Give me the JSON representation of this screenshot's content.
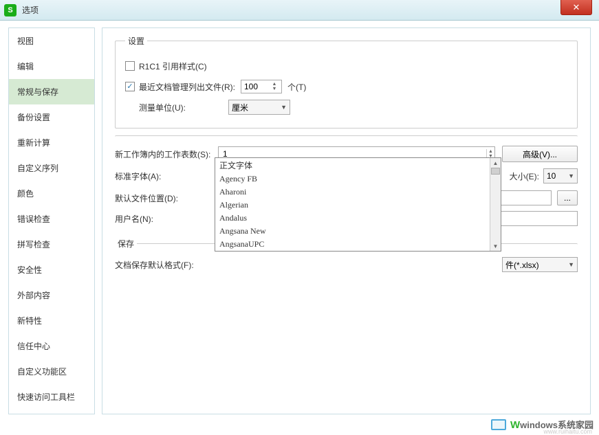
{
  "window": {
    "title": "选项",
    "app_icon_letter": "S"
  },
  "sidebar": {
    "items": [
      {
        "label": "视图"
      },
      {
        "label": "编辑"
      },
      {
        "label": "常规与保存"
      },
      {
        "label": "备份设置"
      },
      {
        "label": "重新计算"
      },
      {
        "label": "自定义序列"
      },
      {
        "label": "颜色"
      },
      {
        "label": "错误检查"
      },
      {
        "label": "拼写检查"
      },
      {
        "label": "安全性"
      },
      {
        "label": "外部内容"
      },
      {
        "label": "新特性"
      },
      {
        "label": "信任中心"
      },
      {
        "label": "自定义功能区"
      },
      {
        "label": "快速访问工具栏"
      }
    ],
    "selected_index": 2
  },
  "settings_group": {
    "legend": "设置",
    "r1c1_label": "R1C1 引用样式(C)",
    "r1c1_checked": false,
    "recent_label": "最近文档管理列出文件(R):",
    "recent_checked": true,
    "recent_value": "100",
    "recent_unit": "个(T)",
    "unit_label": "测量单位(U):",
    "unit_value": "厘米"
  },
  "workbook_group": {
    "sheets_label": "新工作簿内的工作表数(S):",
    "sheets_value": "1",
    "advanced_btn": "高级(V)...",
    "font_label": "标准字体(A):",
    "font_value": "正文字体",
    "size_label": "大小(E):",
    "size_value": "10",
    "default_loc_label": "默认文件位置(D):",
    "username_label": "用户名(N):",
    "dots": "..."
  },
  "font_dropdown": {
    "options": [
      "正文字体",
      "Agency FB",
      "Aharoni",
      "Algerian",
      "Andalus",
      "Angsana New",
      "AngsanaUPC"
    ]
  },
  "save_group": {
    "legend": "保存",
    "format_label": "文档保存默认格式(F):",
    "format_value_suffix": "件(*.xlsx)"
  },
  "watermark": {
    "text": "windows系统家园",
    "url": "www.ruihaitu.com"
  }
}
